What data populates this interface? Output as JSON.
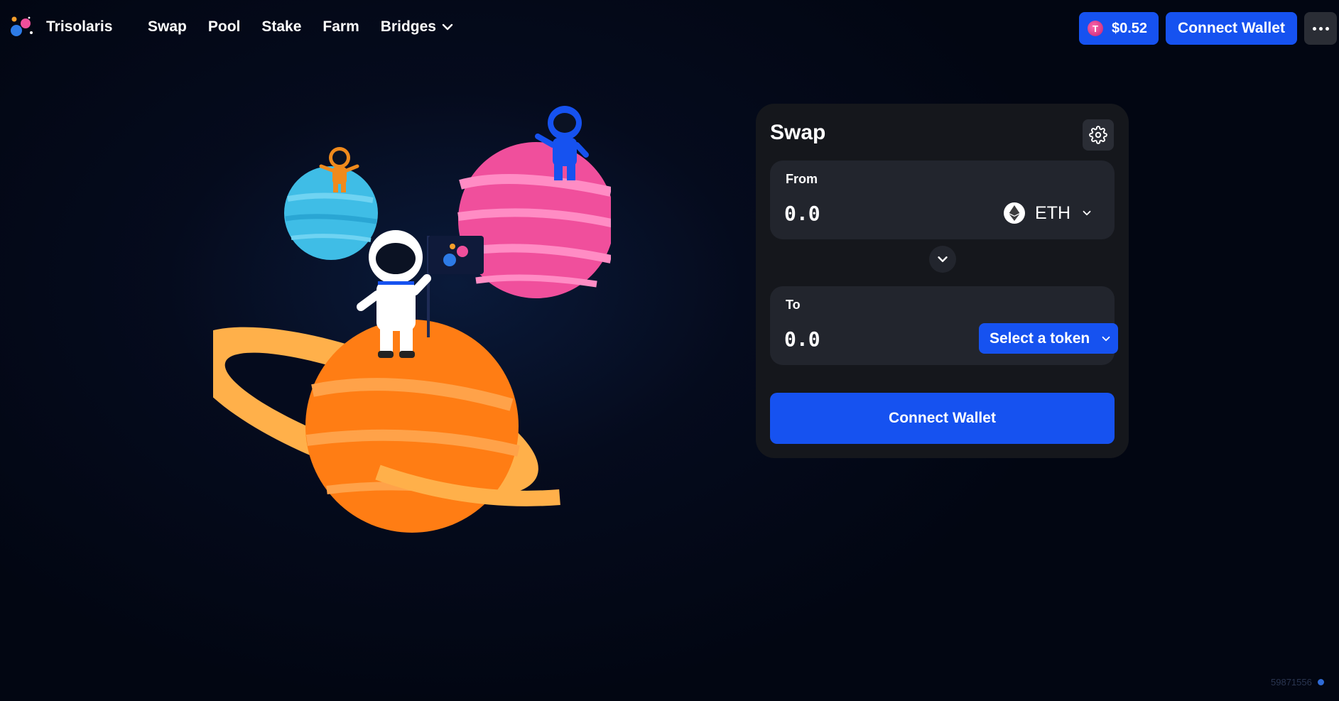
{
  "header": {
    "brand": "Trisolaris",
    "nav": [
      {
        "label": "Swap"
      },
      {
        "label": "Pool"
      },
      {
        "label": "Stake"
      },
      {
        "label": "Farm"
      },
      {
        "label": "Bridges"
      }
    ],
    "price_token_letter": "T",
    "price": "$0.52",
    "connect_label": "Connect Wallet"
  },
  "swap": {
    "title": "Swap",
    "from": {
      "label": "From",
      "placeholder": "0.0",
      "token": "ETH"
    },
    "to": {
      "label": "To",
      "placeholder": "0.0",
      "select_label": "Select a token"
    },
    "connect_label": "Connect Wallet"
  },
  "footer": {
    "version": "59871556"
  },
  "colors": {
    "accent": "#1652f0",
    "card": "#15171c",
    "panel": "#22252d"
  }
}
